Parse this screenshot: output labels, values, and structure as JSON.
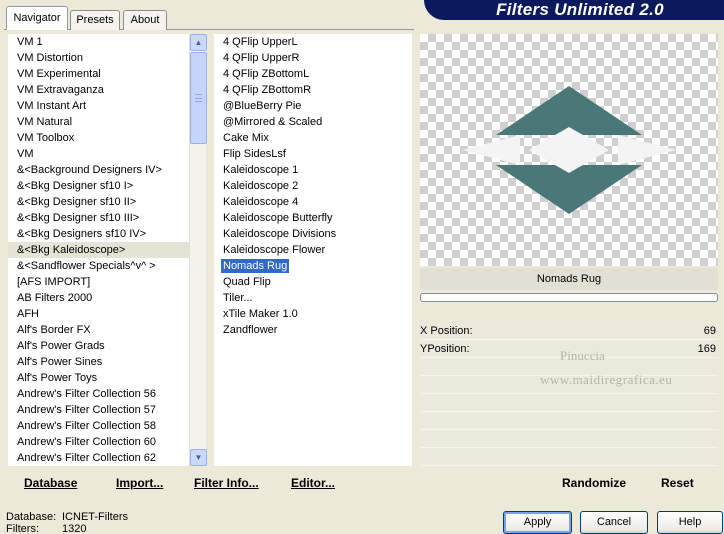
{
  "header": {
    "title": "Filters Unlimited 2.0"
  },
  "tabs": [
    {
      "label": "Navigator",
      "active": true
    },
    {
      "label": "Presets",
      "active": false
    },
    {
      "label": "About",
      "active": false
    }
  ],
  "categories": {
    "items": [
      "VM 1",
      "VM Distortion",
      "VM Experimental",
      "VM Extravaganza",
      "VM Instant Art",
      "VM Natural",
      "VM Toolbox",
      "VM",
      "&<Background Designers IV>",
      "&<Bkg Designer sf10 I>",
      "&<Bkg Designer sf10 II>",
      "&<Bkg Designer sf10 III>",
      "&<Bkg Designers sf10 IV>",
      "&<Bkg Kaleidoscope>",
      "&<Sandflower Specials^v^ >",
      "[AFS IMPORT]",
      "AB Filters 2000",
      "AFH",
      "Alf's Border FX",
      "Alf's Power Grads",
      "Alf's Power Sines",
      "Alf's Power Toys",
      "Andrew's Filter Collection 56",
      "Andrew's Filter Collection 57",
      "Andrew's Filter Collection 58",
      "Andrew's Filter Collection 60",
      "Andrew's Filter Collection 62"
    ],
    "selected_index": 13
  },
  "filters": {
    "items": [
      "4 QFlip UpperL",
      "4 QFlip UpperR",
      "4 QFlip ZBottomL",
      "4 QFlip ZBottomR",
      "@BlueBerry Pie",
      "@Mirrored & Scaled",
      "Cake Mix",
      "Flip SidesLsf",
      "Kaleidoscope 1",
      "Kaleidoscope 2",
      "Kaleidoscope 4",
      "Kaleidoscope Butterfly",
      "Kaleidoscope Divisions",
      "Kaleidoscope Flower",
      "Nomads Rug",
      "Quad Flip",
      "Tiler...",
      "xTile Maker 1.0",
      "Zandflower"
    ],
    "selected_index": 14
  },
  "actions": {
    "database": "Database",
    "import": "Import...",
    "filter_info": "Filter Info...",
    "editor": "Editor..."
  },
  "preview": {
    "filter_name": "Nomads Rug",
    "colors": {
      "dark": "#4a7878",
      "light": "#f4f4f4"
    }
  },
  "params": [
    {
      "label": "X Position:",
      "value": "69"
    },
    {
      "label": "YPosition:",
      "value": "169"
    }
  ],
  "watermark": {
    "line1": "Pinuccia",
    "line2": "www.maidiregrafica.eu"
  },
  "right_buttons": {
    "randomize": "Randomize",
    "reset": "Reset"
  },
  "status": {
    "database_label": "Database:",
    "database_value": "ICNET-Filters",
    "filters_label": "Filters:",
    "filters_value": "1320"
  },
  "dialog_buttons": {
    "apply": "Apply",
    "cancel": "Cancel",
    "help": "Help"
  },
  "icons": {
    "scroll_up": "chevron-up-icon",
    "scroll_down": "chevron-down-icon"
  }
}
